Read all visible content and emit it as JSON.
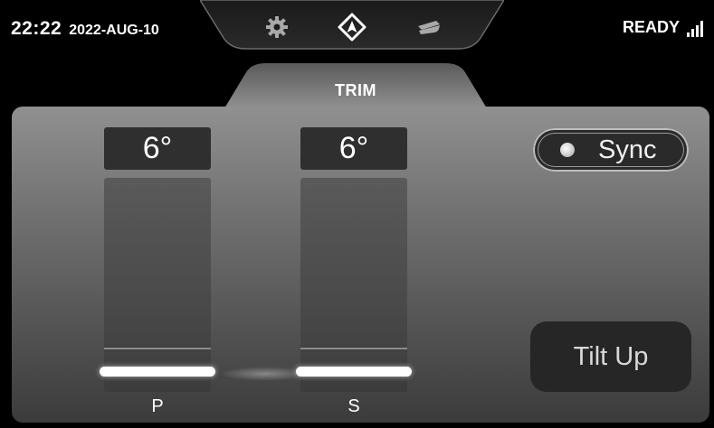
{
  "header": {
    "time": "22:22",
    "date": "2022-AUG-10",
    "status": "READY",
    "signal_icon": "signal-bars-icon",
    "nav_icons": [
      "gear-icon",
      "navigation-arrow-icon",
      "boat-icon"
    ]
  },
  "tab": {
    "label": "TRIM"
  },
  "trim": {
    "port": {
      "angle": "6°",
      "label": "P"
    },
    "starboard": {
      "angle": "6°",
      "label": "S"
    }
  },
  "buttons": {
    "sync_label": "Sync",
    "tilt_up_label": "Tilt Up"
  },
  "colors": {
    "background": "#000000",
    "panel_top": "#909090",
    "panel_bottom": "#3b3b3b",
    "indicator": "#ffffff"
  }
}
